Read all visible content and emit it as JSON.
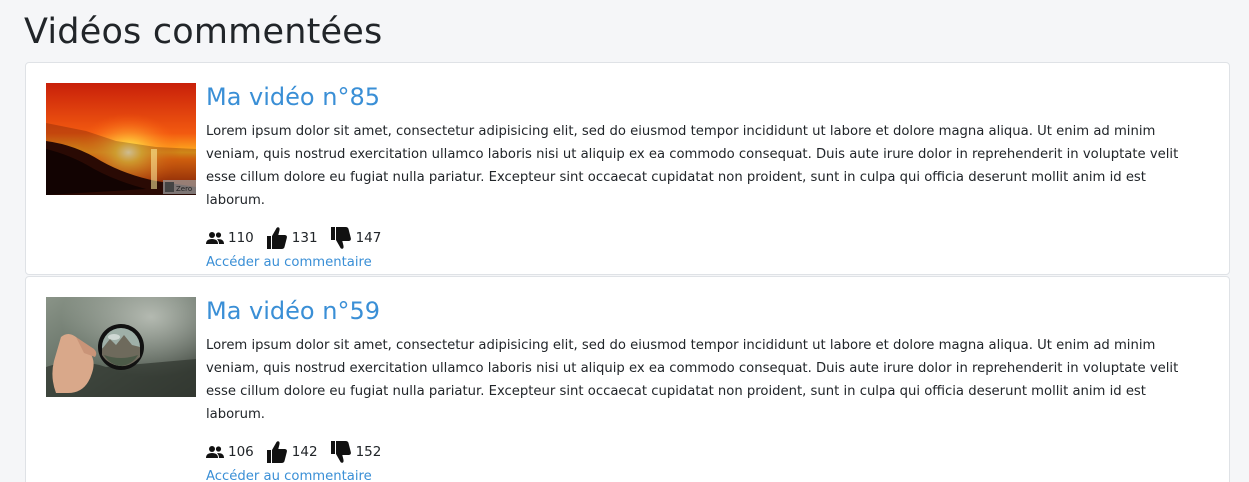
{
  "page": {
    "title": "Vidéos commentées"
  },
  "videos": [
    {
      "title": "Ma vidéo n°85",
      "description": "Lorem ipsum dolor sit amet, consectetur adipisicing elit, sed do eiusmod tempor incididunt ut labore et dolore magna aliqua. Ut enim ad minim veniam, quis nostrud exercitation ullamco laboris nisi ut aliquip ex ea commodo consequat. Duis aute irure dolor in reprehenderit in voluptate velit esse cillum dolore eu fugiat nulla pariatur. Excepteur sint occaecat cupidatat non proident, sunt in culpa qui officia deserunt mollit anim id est laborum.",
      "viewers": "110",
      "likes": "131",
      "dislikes": "147",
      "link_label": "Accéder au commentaire",
      "thumbnail": "sunset-over-sea",
      "thumbnail_watermark": "Zero"
    },
    {
      "title": "Ma vidéo n°59",
      "description": "Lorem ipsum dolor sit amet, consectetur adipisicing elit, sed do eiusmod tempor incididunt ut labore et dolore magna aliqua. Ut enim ad minim veniam, quis nostrud exercitation ullamco laboris nisi ut aliquip ex ea commodo consequat. Duis aute irure dolor in reprehenderit in voluptate velit esse cillum dolore eu fugiat nulla pariatur. Excepteur sint occaecat cupidatat non proident, sunt in culpa qui officia deserunt mollit anim id est laborum.",
      "viewers": "106",
      "likes": "142",
      "dislikes": "152",
      "link_label": "Accéder au commentaire",
      "thumbnail": "hand-holding-lens-ball"
    }
  ],
  "icons": {
    "viewers": "users-icon",
    "likes": "thumbs-up-icon",
    "dislikes": "thumbs-down-icon"
  },
  "colors": {
    "link": "#3a8fd6",
    "text": "#212529",
    "background": "#f5f6f8",
    "card": "#ffffff"
  }
}
